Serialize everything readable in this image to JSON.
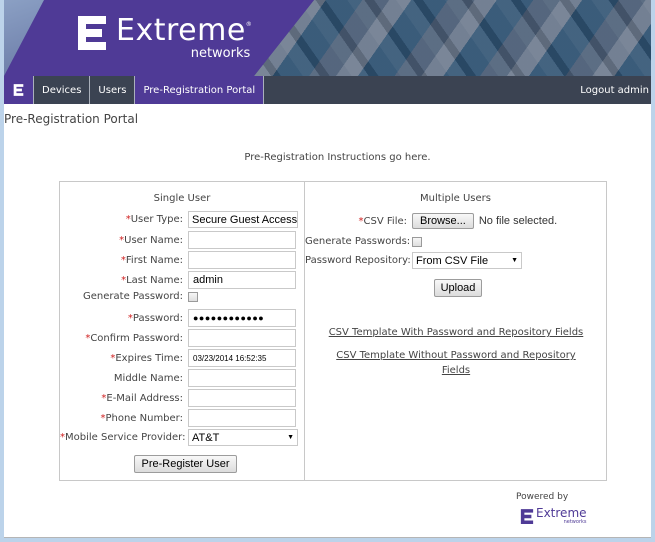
{
  "banner": {
    "brand": "Extreme",
    "subbrand": "networks",
    "logo_icon": "extreme-e-logo-icon"
  },
  "nav": {
    "logo_icon": "extreme-e-logo-icon",
    "items": [
      {
        "label": "Devices",
        "active": false
      },
      {
        "label": "Users",
        "active": false
      },
      {
        "label": "Pre-Registration Portal",
        "active": true
      }
    ],
    "logout_label": "Logout admin"
  },
  "page": {
    "title": "Pre-Registration Portal",
    "instructions": "Pre-Registration Instructions go here."
  },
  "single_user": {
    "title": "Single User",
    "required_marker": "*",
    "fields": {
      "user_type": {
        "label": "User Type:",
        "required": true,
        "value": "Secure Guest Access"
      },
      "user_name": {
        "label": "User Name:",
        "required": true,
        "value": ""
      },
      "first_name": {
        "label": "First Name:",
        "required": true,
        "value": ""
      },
      "last_name": {
        "label": "Last Name:",
        "required": true,
        "value": "admin"
      },
      "generate_password": {
        "label": "Generate Password:",
        "required": false,
        "checked": false
      },
      "password": {
        "label": "Password:",
        "required": true,
        "value": "●●●●●●●●●●●●"
      },
      "confirm_password": {
        "label": "Confirm Password:",
        "required": true,
        "value": ""
      },
      "expires_time": {
        "label": "Expires Time:",
        "required": true,
        "value": "03/23/2014 16:52:35"
      },
      "middle_name": {
        "label": "Middle Name:",
        "required": false,
        "value": ""
      },
      "email": {
        "label": "E-Mail Address:",
        "required": true,
        "value": ""
      },
      "phone": {
        "label": "Phone Number:",
        "required": true,
        "value": ""
      },
      "mobile_provider": {
        "label": "Mobile Service Provider:",
        "required": true,
        "value": "AT&T"
      }
    },
    "submit_label": "Pre-Register User"
  },
  "multiple_users": {
    "title": "Multiple Users",
    "csv_file": {
      "label": "CSV File:",
      "required": true,
      "browse_label": "Browse...",
      "status": "No file selected."
    },
    "generate_passwords": {
      "label": "Generate Passwords:",
      "checked": false
    },
    "password_repository": {
      "label": "Password Repository:",
      "value": "From CSV File"
    },
    "upload_label": "Upload",
    "links": [
      "CSV Template With Password and Repository Fields",
      "CSV Template Without Password and Repository Fields"
    ]
  },
  "footer": {
    "powered_by": "Powered by",
    "brand": "Extreme",
    "subbrand": "networks"
  },
  "colors": {
    "brand_purple": "#4f3a96",
    "nav_dark": "#3b4352",
    "required_red": "#d02020"
  }
}
